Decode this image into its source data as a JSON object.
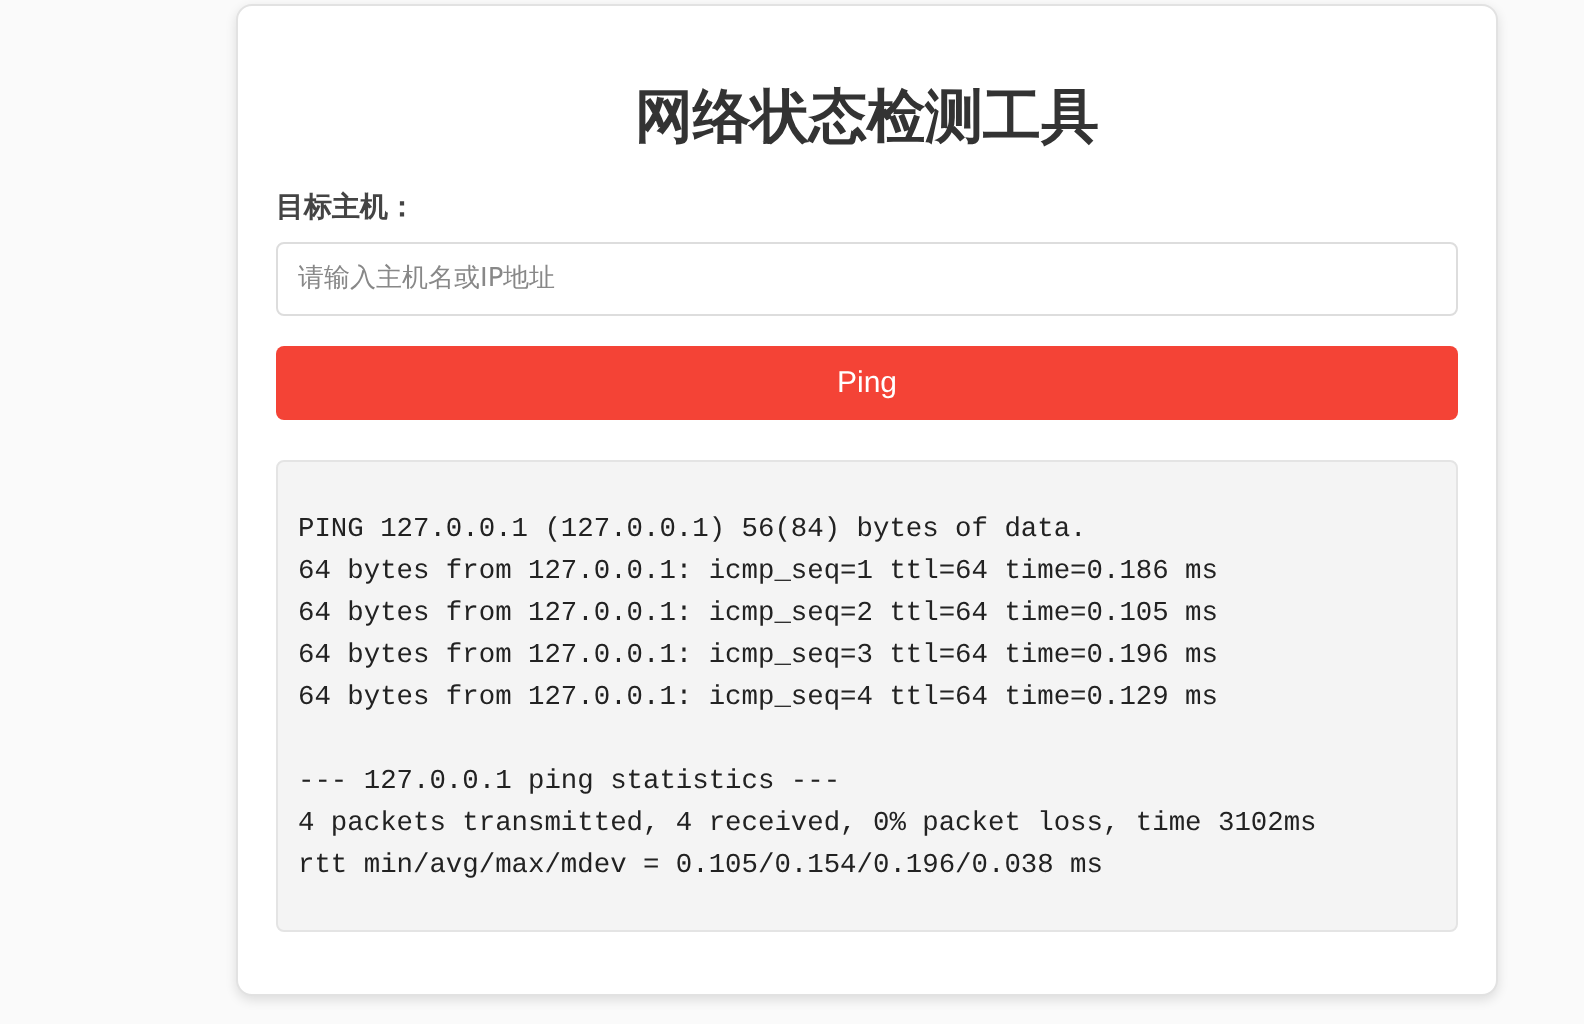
{
  "title": "网络状态检测工具",
  "host_field": {
    "label": "目标主机：",
    "placeholder": "请输入主机名或IP地址"
  },
  "ping_button": {
    "label": "Ping"
  },
  "output": {
    "sections": [
      {
        "lines": [
          "PING 127.0.0.1 (127.0.0.1) 56(84) bytes of data.",
          "64 bytes from 127.0.0.1: icmp_seq=1 ttl=64 time=0.186 ms",
          "64 bytes from 127.0.0.1: icmp_seq=2 ttl=64 time=0.105 ms",
          "64 bytes from 127.0.0.1: icmp_seq=3 ttl=64 time=0.196 ms",
          "64 bytes from 127.0.0.1: icmp_seq=4 ttl=64 time=0.129 ms"
        ]
      },
      {
        "lines": [
          "--- 127.0.0.1 ping statistics ---",
          "4 packets transmitted, 4 received, 0% packet loss, time 3102ms",
          "rtt min/avg/max/mdev = 0.105/0.154/0.196/0.038 ms"
        ]
      }
    ]
  }
}
